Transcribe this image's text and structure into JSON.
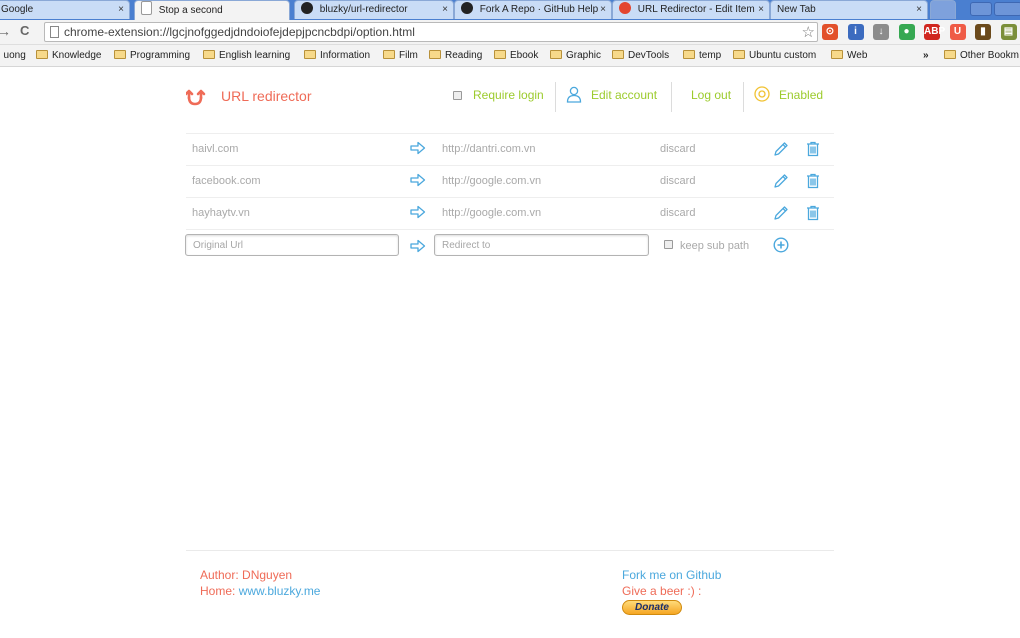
{
  "browser": {
    "tabs": [
      {
        "label": "Google"
      },
      {
        "label": "Stop a second"
      },
      {
        "label": "bluzky/url-redirector"
      },
      {
        "label": "Fork A Repo · GitHub Help"
      },
      {
        "label": "URL Redirector - Edit Item"
      },
      {
        "label": "New Tab"
      }
    ],
    "close_glyph": "×",
    "back_glyph": "→",
    "reload_glyph": "C",
    "url": "chrome-extension://lgcjnofggedjdndoiofejdepjpcncbdpi/option.html",
    "star_glyph": "☆",
    "extensions": [
      {
        "glyph": "⊙",
        "color": "#e2502a"
      },
      {
        "glyph": "i",
        "color": "#3c6bbf"
      },
      {
        "glyph": "↓",
        "color": "#8c8c8c"
      },
      {
        "glyph": "●",
        "color": "#36a852"
      },
      {
        "glyph": "ABP",
        "color": "#d0261f"
      },
      {
        "glyph": "U",
        "color": "#ef5b46"
      },
      {
        "glyph": "▮",
        "color": "#6b4a1c"
      },
      {
        "glyph": "▤",
        "color": "#7b8f3a"
      },
      {
        "glyph": "≡",
        "color": "#666666"
      }
    ],
    "bookmarks": [
      "ı uong",
      "Knowledge",
      "Programming",
      "English learning",
      "Information",
      "Film",
      "Reading",
      "Ebook",
      "Graphic",
      "DevTools",
      "temp",
      "Ubuntu custom",
      "Web"
    ],
    "bookmark_overflow": "»",
    "other_bookmarks": "Other Bookm"
  },
  "header": {
    "title": "URL redirector",
    "require_login_label": "Require login",
    "edit_account_label": "Edit account",
    "logout_label": "Log out",
    "enabled_label": "Enabled"
  },
  "rules": [
    {
      "original": "haivl.com",
      "redirect": "http://dantri.com.vn",
      "option": "discard"
    },
    {
      "original": "facebook.com",
      "redirect": "http://google.com.vn",
      "option": "discard"
    },
    {
      "original": "hayhaytv.vn",
      "redirect": "http://google.com.vn",
      "option": "discard"
    }
  ],
  "new_rule": {
    "original_placeholder": "Original Url",
    "redirect_placeholder": "Redirect to",
    "keep_sub_path_label": "keep sub path"
  },
  "footer": {
    "author_prefix": "Author: ",
    "author_name": "DNguyen",
    "home_prefix": "Home: ",
    "home_link": "www.bluzky.me",
    "fork_label": "Fork me on Github",
    "beer_label": "Give a beer :) :",
    "donate_label": "Donate"
  },
  "colors": {
    "accent_red": "#ef6b57",
    "accent_green": "#9ccb2c",
    "accent_blue": "#4ba8dd"
  }
}
